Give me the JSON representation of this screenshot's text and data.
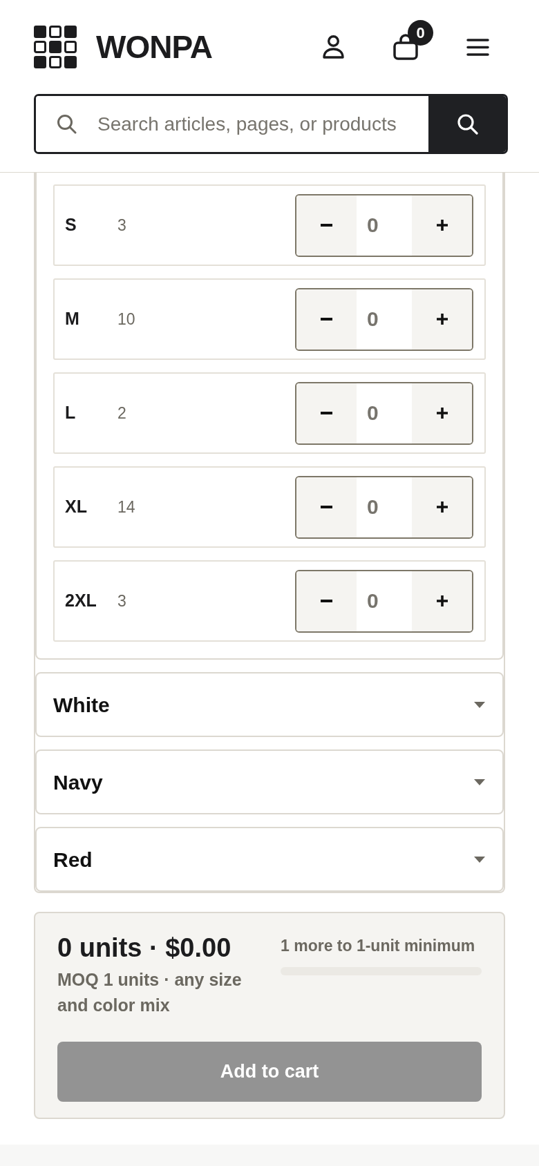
{
  "header": {
    "brand": "WONPA",
    "cart_count": "0",
    "search": {
      "placeholder": "Search articles, pages, or products"
    }
  },
  "color_groups": [
    {
      "expanded": true,
      "sizes": [
        {
          "size": "S",
          "stock": "3",
          "quantity": "0"
        },
        {
          "size": "M",
          "stock": "10",
          "quantity": "0"
        },
        {
          "size": "L",
          "stock": "2",
          "quantity": "0"
        },
        {
          "size": "XL",
          "stock": "14",
          "quantity": "0"
        },
        {
          "size": "2XL",
          "stock": "3",
          "quantity": "0"
        }
      ]
    },
    {
      "name": "White",
      "expanded": false
    },
    {
      "name": "Navy",
      "expanded": false
    },
    {
      "name": "Red",
      "expanded": false
    }
  ],
  "summary": {
    "total": "0 units · $0.00",
    "moq_note": "MOQ 1 units · any size and color mix",
    "progress_label": "1 more to 1-unit minimum",
    "level": 0,
    "add_to_cart": {
      "label": "Add to cart",
      "disabled": true
    }
  }
}
